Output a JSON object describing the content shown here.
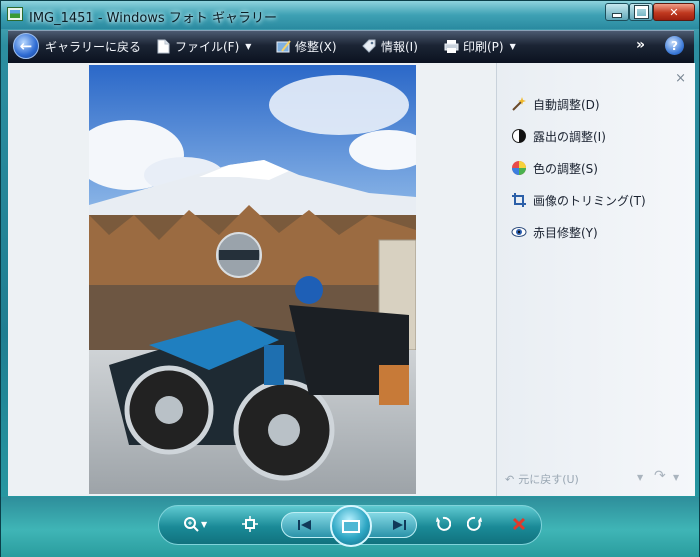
{
  "window": {
    "title": "IMG_1451 - Windows フォト ギャラリー"
  },
  "toolbar": {
    "back_label": "ギャラリーに戻る",
    "file_label": "ファイル(F)",
    "fix_label": "修整(X)",
    "info_label": "情報(I)",
    "print_label": "印刷(P)",
    "more_label": "»"
  },
  "fix_panel": {
    "items": [
      {
        "label": "自動調整(D)",
        "icon": "magic-wand-icon"
      },
      {
        "label": "露出の調整(I)",
        "icon": "exposure-icon"
      },
      {
        "label": "色の調整(S)",
        "icon": "color-wheel-icon"
      },
      {
        "label": "画像のトリミング(T)",
        "icon": "crop-icon"
      },
      {
        "label": "赤目修整(Y)",
        "icon": "red-eye-icon"
      }
    ],
    "undo_label": "元に戻す(U)"
  },
  "colors": {
    "accent": "#2a93a9",
    "close": "#c0391f",
    "toolbar": "#1b2434"
  }
}
